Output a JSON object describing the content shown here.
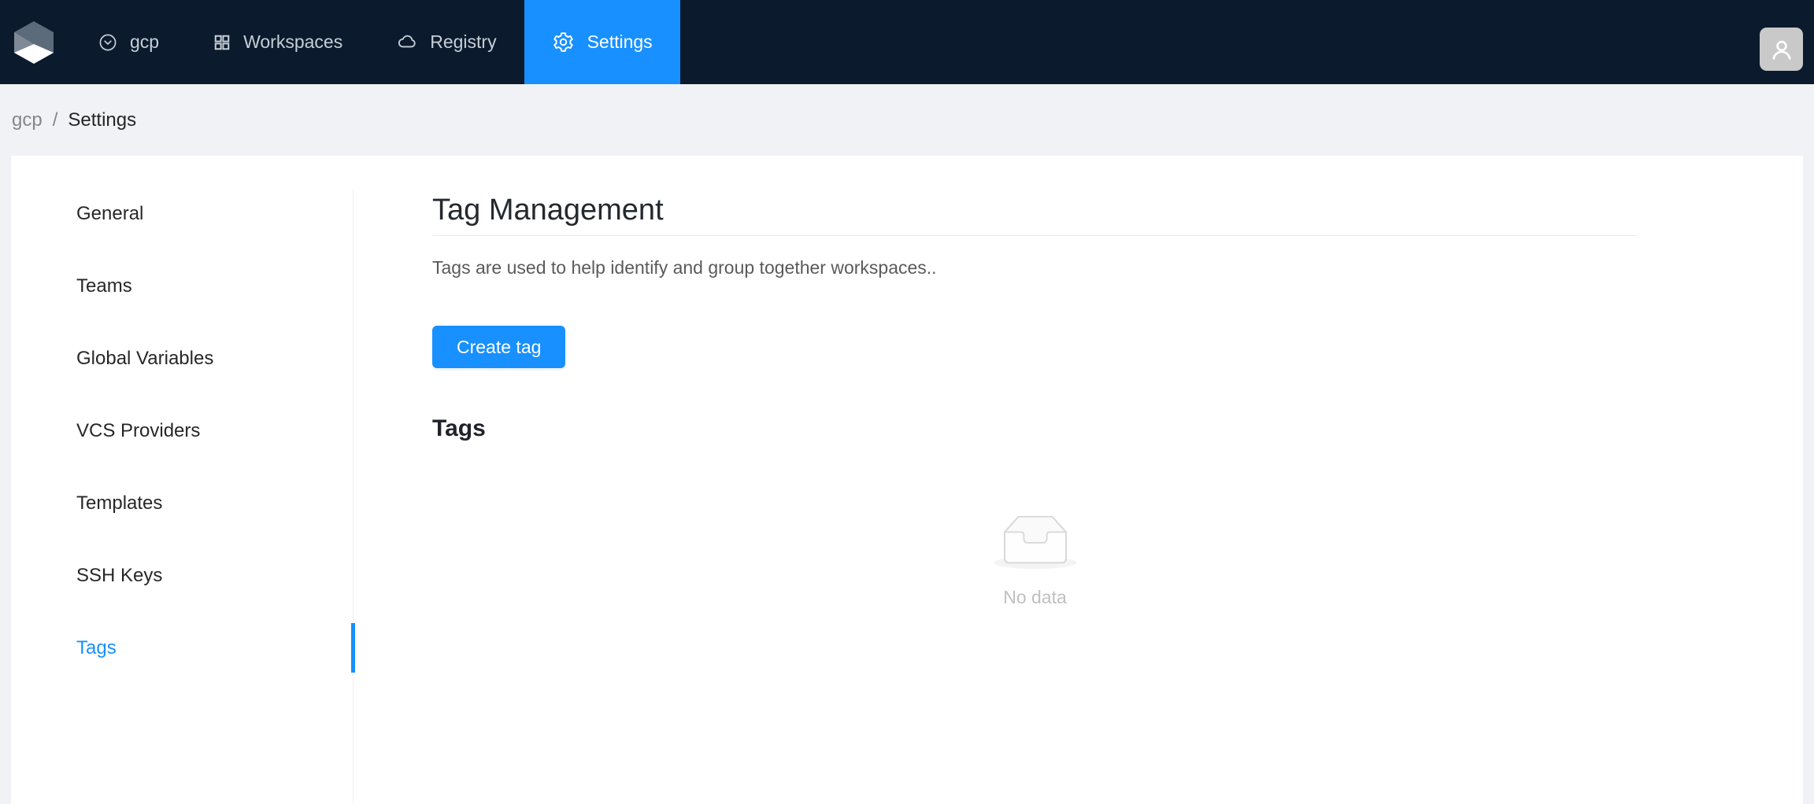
{
  "nav": {
    "logo_icon": "cube-logo-icon",
    "items": [
      {
        "label": "gcp",
        "icon": "chevron-down-circle-icon",
        "active": false
      },
      {
        "label": "Workspaces",
        "icon": "app-grid-icon",
        "active": false
      },
      {
        "label": "Registry",
        "icon": "cloud-icon",
        "active": false
      },
      {
        "label": "Settings",
        "icon": "gear-icon",
        "active": true
      }
    ],
    "avatar_icon": "user-icon"
  },
  "breadcrumb": {
    "org": "gcp",
    "separator": "/",
    "current": "Settings"
  },
  "sidebar": {
    "items": [
      {
        "label": "General",
        "active": false
      },
      {
        "label": "Teams",
        "active": false
      },
      {
        "label": "Global Variables",
        "active": false
      },
      {
        "label": "VCS Providers",
        "active": false
      },
      {
        "label": "Templates",
        "active": false
      },
      {
        "label": "SSH Keys",
        "active": false
      },
      {
        "label": "Tags",
        "active": true
      }
    ]
  },
  "main": {
    "title": "Tag Management",
    "description": "Tags are used to help identify and group together workspaces..",
    "create_button": "Create tag",
    "section_heading": "Tags",
    "empty": {
      "icon": "inbox-icon",
      "text": "No data"
    }
  },
  "colors": {
    "primary": "#1890ff",
    "header_bg": "#0b1b2d",
    "page_bg": "#f0f2f5",
    "avatar_bg": "#c9c9c9",
    "active_link": "#1890ff"
  }
}
